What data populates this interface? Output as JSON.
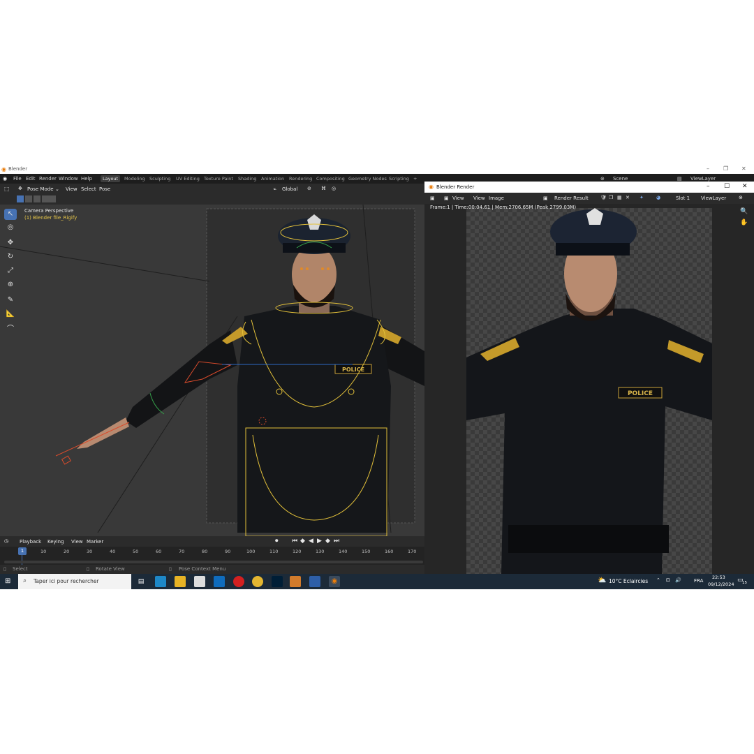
{
  "window": {
    "title": "Blender"
  },
  "menubar": {
    "menus": [
      "File",
      "Edit",
      "Render",
      "Window",
      "Help"
    ],
    "workspaces": [
      "Layout",
      "Modeling",
      "Sculpting",
      "UV Editing",
      "Texture Paint",
      "Shading",
      "Animation",
      "Rendering",
      "Compositing",
      "Geometry Nodes",
      "Scripting"
    ],
    "active_workspace": "Layout",
    "add_tab": "+",
    "scene": "Scene",
    "view_layer": "ViewLayer"
  },
  "viewport_header": {
    "mode": "Pose Mode",
    "menus": [
      "View",
      "Select",
      "Pose"
    ],
    "orientation": "Global"
  },
  "viewport": {
    "camera_label": "Camera Perspective",
    "object_label": "(1) Blender file_Rigify",
    "badge_text": "POLICE"
  },
  "timeline": {
    "menus": [
      "Playback",
      "Keying",
      "View",
      "Marker"
    ],
    "current_frame": "1",
    "ticks": [
      "10",
      "20",
      "30",
      "40",
      "50",
      "60",
      "70",
      "80",
      "90",
      "100",
      "110",
      "120",
      "130",
      "140",
      "150",
      "160",
      "170"
    ]
  },
  "statusbar": {
    "items": [
      "Select",
      "Rotate View",
      "Pose Context Menu"
    ]
  },
  "render_window": {
    "title": "Blender Render",
    "menus": [
      "View",
      "View",
      "Image"
    ],
    "image_name": "Render Result",
    "slot": "Slot 1",
    "view_layer": "ViewLayer",
    "info": "Frame:1 | Time:00:04.61 | Mem:2706.65M (Peak 2799.03M)",
    "badge_text": "POLICE"
  },
  "taskbar": {
    "search_placeholder": "Taper ici pour rechercher",
    "weather": "10°C  Eclaircies",
    "language": "FRA",
    "time": "22:53",
    "date": "09/12/2024",
    "notification_count": "15"
  },
  "colors": {
    "blender_bg": "#393939",
    "header_bg": "#2b2b2b",
    "accent": "#4772b3",
    "rig_yellow": "#e3c13a",
    "taskbar": "#1c2a38"
  }
}
